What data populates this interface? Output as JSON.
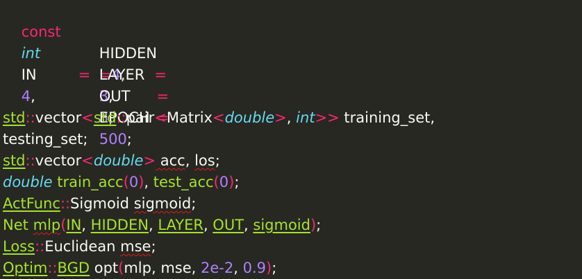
{
  "editor": {
    "line1": {
      "kw": "const",
      "ty": "int",
      "name": "IN",
      "eq": "=",
      "val": "4",
      "punct": ","
    },
    "line2": {
      "name": "HIDDEN",
      "eq": "=",
      "val": "4",
      "punct": ","
    },
    "line3": {
      "name": "LAYER",
      "eq": "=",
      "val": "3",
      "punct": ","
    },
    "line4": {
      "name": "OUT",
      "eq": "=",
      "val": "3",
      "punct": ","
    },
    "line5": {
      "name": "EPOCH",
      "eq": "=",
      "val": "500",
      "punct": ";"
    },
    "line6": {
      "std1": "std",
      "sep1": "::",
      "vector": "vector",
      "lt1": "<",
      "std2": "std",
      "sep2": "::",
      "pair": "pair",
      "lt2": "<",
      "matrix": "Matrix",
      "lt3": "<",
      "double": "double",
      "gt3": ">",
      "comma": ", ",
      "int": "int",
      "gt2": ">>",
      "name": " training_set,"
    },
    "line7": {
      "text": "testing_set;"
    },
    "line8": {
      "std": "std",
      "sep": "::",
      "vector": "vector",
      "lt": "<",
      "double": "double",
      "gt": ">",
      "a": " acc",
      "comma": ", ",
      "b": "los",
      "end": ";"
    },
    "line9": {
      "double": "double",
      "fn1": " train_acc",
      "p1o": "(",
      "v1": "0",
      "p1c": ")",
      "comma": ", ",
      "fn2": "test_acc",
      "p2o": "(",
      "v2": "0",
      "p2c": ")",
      "end": ";"
    },
    "line10": {
      "ns": "ActFunc",
      "sep": "::",
      "cls": "Sigmoid",
      "sp": " ",
      "var": "sigmoid",
      "end": ";"
    },
    "line11": {
      "cls": "Net",
      "sp": " ",
      "var": "mlp",
      "po": "(",
      "a1": "IN",
      "c1": ", ",
      "a2": "HIDDEN",
      "c2": ", ",
      "a3": "LAYER",
      "c3": ", ",
      "a4": "OUT",
      "c4": ", ",
      "a5": "sigmoid",
      "pc": ")",
      "end": ";"
    },
    "line12": {
      "ns": "Loss",
      "sep": "::",
      "cls": "Euclidean",
      "sp": " ",
      "var": "mse",
      "end": ";"
    },
    "line13": {
      "ns": "Optim",
      "sep": "::",
      "cls": "BGD",
      "sp": " ",
      "var": "opt",
      "po": "(",
      "a1": "mlp",
      "c1": ", ",
      "a2": "mse",
      "c2": ", ",
      "n1": "2e-2",
      "c3": ", ",
      "n2": "0.9",
      "pc": ")",
      "end": ";"
    }
  },
  "colors": {
    "background": "#272822",
    "keyword": "#f92672",
    "type": "#66d9ef",
    "number": "#ae81ff",
    "class": "#a6e22e",
    "text": "#f8f8f2",
    "squiggle": "#e01b1b"
  }
}
